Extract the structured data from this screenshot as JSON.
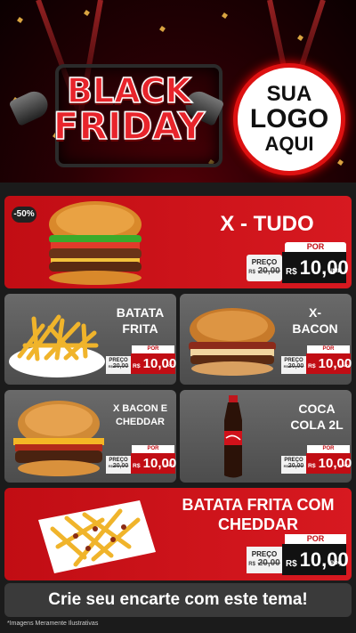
{
  "header": {
    "brand_line1": "BLACK",
    "brand_line2": "FRIDAY",
    "logo": {
      "line1": "SUA",
      "line2": "LOGO",
      "line3": "AQUI"
    }
  },
  "products": [
    {
      "id": "x-tudo",
      "name": "X - TUDO",
      "badge": "-50%",
      "price_label": "PREÇO",
      "por_label": "POR",
      "old_price": "20,00",
      "old_prefix": "R$",
      "currency": "R$",
      "new_price": "10,00",
      "unit": "UNID"
    },
    {
      "id": "batata-frita",
      "name": "BATATA\nFRITA",
      "price_label": "PREÇO",
      "por_label": "POR",
      "old_price": "20,00",
      "old_prefix": "R$",
      "currency": "R$",
      "new_price": "10,00",
      "unit": "POÇ"
    },
    {
      "id": "x-bacon",
      "name": "X-\nBACON",
      "price_label": "PREÇO",
      "por_label": "POR",
      "old_price": "20,00",
      "old_prefix": "R$",
      "currency": "R$",
      "new_price": "10,00",
      "unit": "UNID"
    },
    {
      "id": "x-bacon-cheddar",
      "name": "X BACON E\nCHEDDAR",
      "price_label": "PREÇO",
      "por_label": "POR",
      "old_price": "20,00",
      "old_prefix": "R$",
      "currency": "R$",
      "new_price": "10,00",
      "unit": "UNID"
    },
    {
      "id": "coca-cola",
      "name": "COCA\nCOLA 2L",
      "price_label": "PREÇO",
      "por_label": "POR",
      "old_price": "20,00",
      "old_prefix": "R$",
      "currency": "R$",
      "new_price": "10,00",
      "unit": "UNID"
    },
    {
      "id": "batata-cheddar",
      "name": "BATATA FRITA COM\nCHEDDAR",
      "price_label": "PREÇO",
      "por_label": "POR",
      "old_price": "20,00",
      "old_prefix": "R$",
      "currency": "R$",
      "new_price": "10,00",
      "unit": "POÇ"
    }
  ],
  "footer": {
    "cta": "Crie seu encarte com este tema!",
    "disclaimer": "*Imagens Meramente Ilustrativas"
  },
  "colors": {
    "brand_red": "#c10d14",
    "card_gray": "#5a5a5a",
    "background": "#1b1b1b"
  }
}
